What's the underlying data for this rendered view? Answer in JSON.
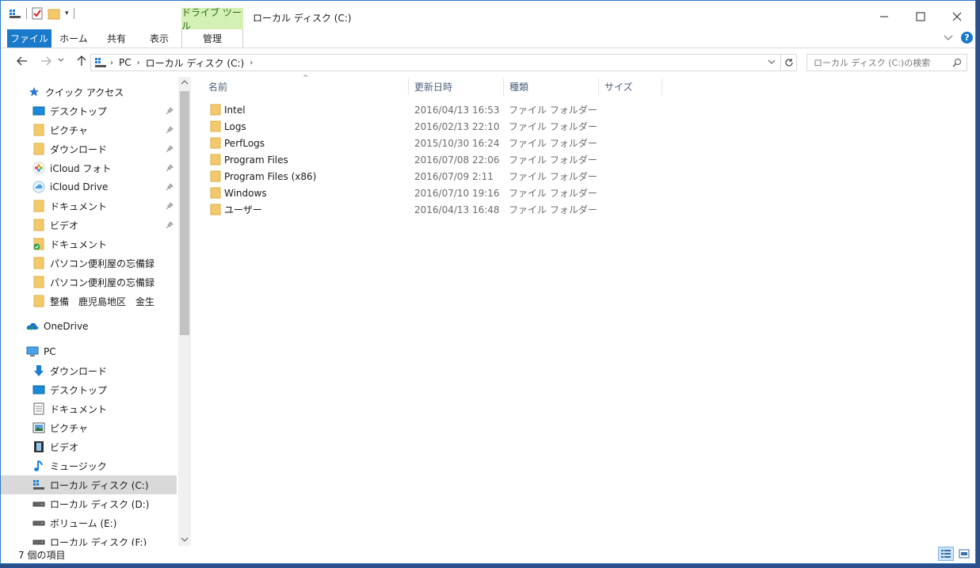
{
  "window": {
    "title": "ローカル ディスク (C:)",
    "context_tab_group": "ドライブ ツール"
  },
  "ribbon": {
    "tabs": [
      {
        "label": "ファイル"
      },
      {
        "label": "ホーム"
      },
      {
        "label": "共有"
      },
      {
        "label": "表示"
      },
      {
        "label": "管理"
      }
    ]
  },
  "address": {
    "crumbs": [
      "PC",
      "ローカル ディスク (C:)"
    ],
    "search_placeholder": "ローカル ディスク (C:)の検索"
  },
  "nav": {
    "quick_access_label": "クイック アクセス",
    "quick_access": [
      {
        "label": "デスクトップ",
        "icon": "desktop-icon",
        "pinned": true
      },
      {
        "label": "ピクチャ",
        "icon": "folder-icon",
        "pinned": true
      },
      {
        "label": "ダウンロード",
        "icon": "folder-icon",
        "pinned": true
      },
      {
        "label": "iCloud フォト",
        "icon": "icloud-photos-icon",
        "pinned": true
      },
      {
        "label": "iCloud Drive",
        "icon": "icloud-drive-icon",
        "pinned": true
      },
      {
        "label": "ドキュメント",
        "icon": "folder-icon",
        "pinned": true
      },
      {
        "label": "ビデオ",
        "icon": "folder-icon",
        "pinned": true
      },
      {
        "label": "ドキュメント",
        "icon": "folder-check-icon",
        "pinned": false
      },
      {
        "label": "パソコン便利屋の忘備録",
        "icon": "folder-icon",
        "pinned": false
      },
      {
        "label": "パソコン便利屋の忘備録",
        "icon": "folder-icon",
        "pinned": false
      },
      {
        "label": "整備　鹿児島地区　金生",
        "icon": "folder-icon",
        "pinned": false
      }
    ],
    "onedrive_label": "OneDrive",
    "pc_label": "PC",
    "pc_items": [
      {
        "label": "ダウンロード",
        "icon": "download-icon"
      },
      {
        "label": "デスクトップ",
        "icon": "desktop-icon"
      },
      {
        "label": "ドキュメント",
        "icon": "document-icon"
      },
      {
        "label": "ピクチャ",
        "icon": "picture-icon"
      },
      {
        "label": "ビデオ",
        "icon": "video-icon"
      },
      {
        "label": "ミュージック",
        "icon": "music-icon"
      },
      {
        "label": "ローカル ディスク (C:)",
        "icon": "system-drive-icon",
        "selected": true
      },
      {
        "label": "ローカル ディスク (D:)",
        "icon": "drive-icon"
      },
      {
        "label": "ボリューム (E:)",
        "icon": "drive-icon"
      },
      {
        "label": "ローカル ディスク (F:)",
        "icon": "drive-icon"
      }
    ]
  },
  "columns": {
    "name": "名前",
    "modified": "更新日時",
    "type": "種類",
    "size": "サイズ"
  },
  "files": [
    {
      "name": "Intel",
      "modified": "2016/04/13 16:53",
      "type": "ファイル フォルダー"
    },
    {
      "name": "Logs",
      "modified": "2016/02/13 22:10",
      "type": "ファイル フォルダー"
    },
    {
      "name": "PerfLogs",
      "modified": "2015/10/30 16:24",
      "type": "ファイル フォルダー"
    },
    {
      "name": "Program Files",
      "modified": "2016/07/08 22:06",
      "type": "ファイル フォルダー"
    },
    {
      "name": "Program Files (x86)",
      "modified": "2016/07/09 2:11",
      "type": "ファイル フォルダー"
    },
    {
      "name": "Windows",
      "modified": "2016/07/10 19:16",
      "type": "ファイル フォルダー"
    },
    {
      "name": "ユーザー",
      "modified": "2016/04/13 16:48",
      "type": "ファイル フォルダー"
    }
  ],
  "status": {
    "item_count": "7 個の項目"
  },
  "colors": {
    "accent": "#1979ca",
    "context_tab": "#d4f0b4",
    "folder": "#f3c96b",
    "selected": "#d9d9d9"
  }
}
